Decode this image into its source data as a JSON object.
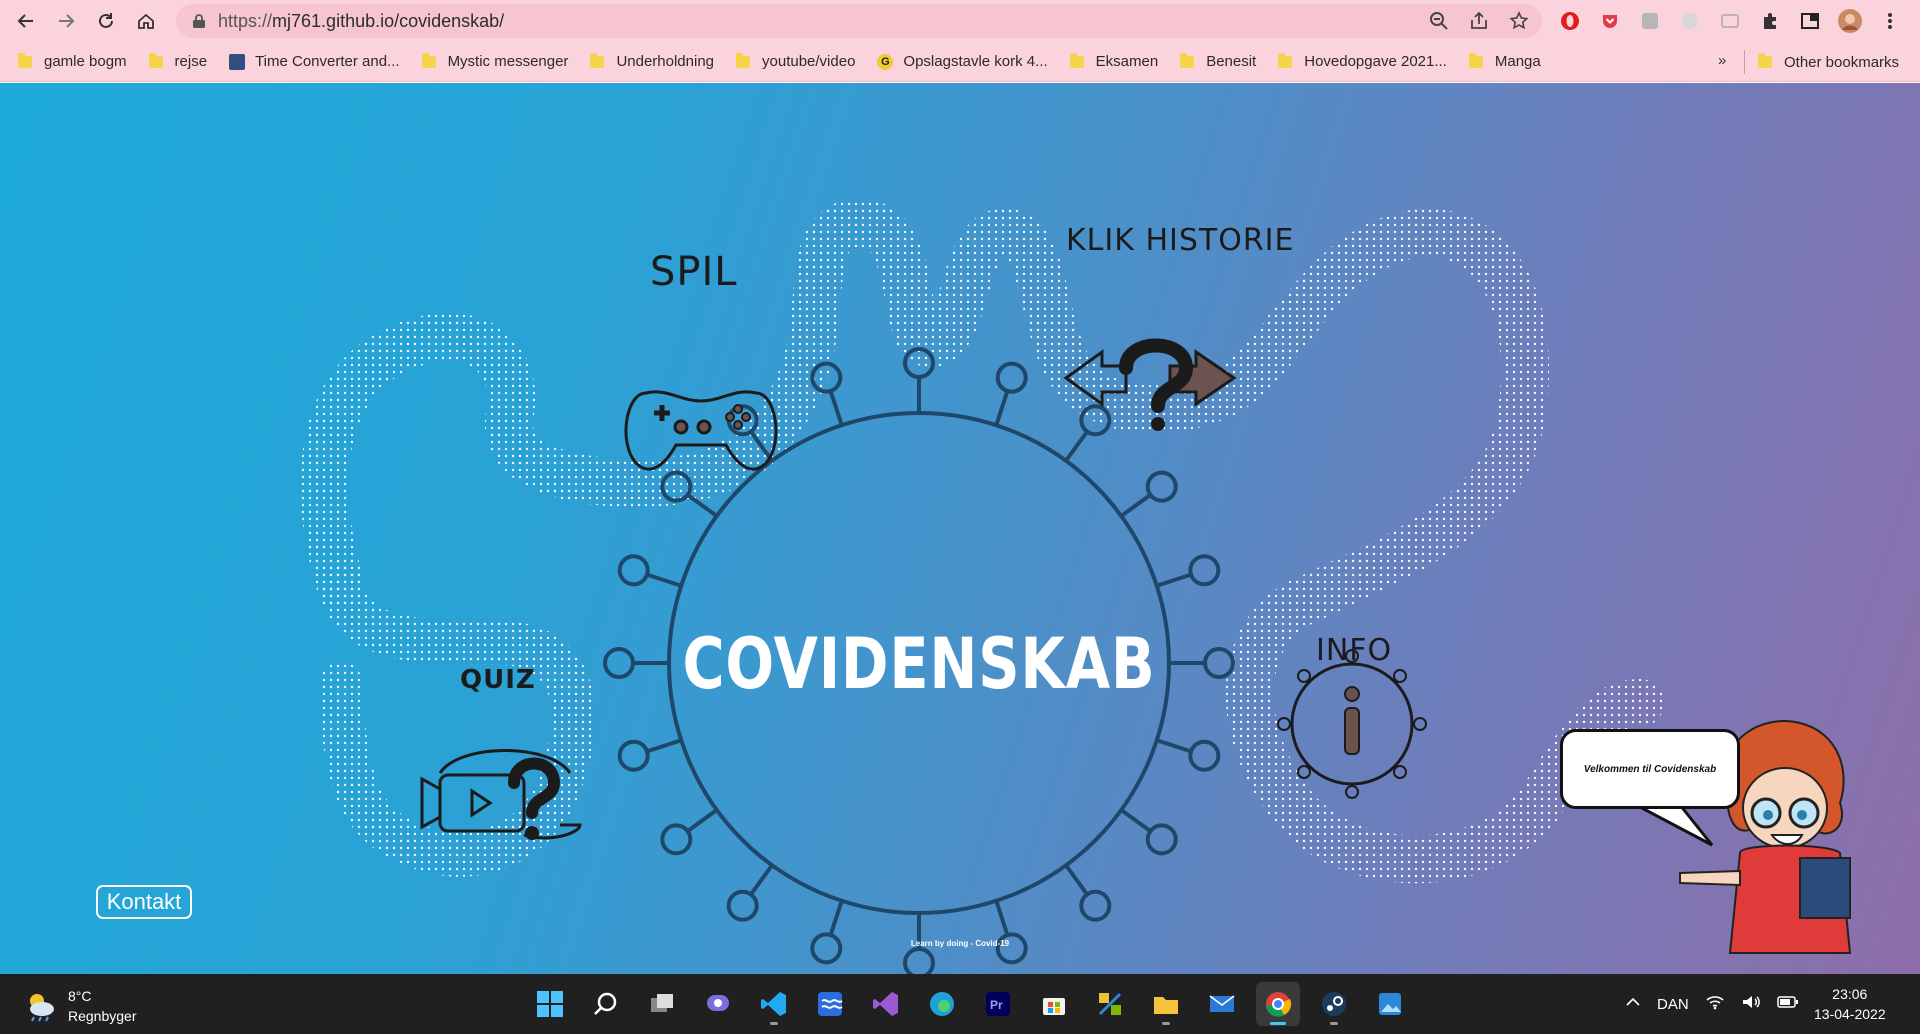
{
  "browser": {
    "url_scheme": "https://",
    "url_rest": "mj761.github.io/covidenskab/",
    "bookmarks": [
      {
        "label": "gamle bogm",
        "icon": "folder-icon"
      },
      {
        "label": "rejse",
        "icon": "folder-icon"
      },
      {
        "label": "Time Converter and...",
        "icon": "timeconverter-icon"
      },
      {
        "label": "Mystic messenger",
        "icon": "folder-icon"
      },
      {
        "label": "Underholdning",
        "icon": "folder-icon"
      },
      {
        "label": "youtube/video",
        "icon": "folder-icon"
      },
      {
        "label": "Opslagstavle kork 4...",
        "icon": "g-logo-icon"
      },
      {
        "label": "Eksamen",
        "icon": "folder-icon"
      },
      {
        "label": "Benesit",
        "icon": "folder-icon"
      },
      {
        "label": "Hovedopgave 2021...",
        "icon": "folder-icon"
      },
      {
        "label": "Manga",
        "icon": "folder-icon"
      }
    ],
    "bookmarks_more": "»",
    "other_bookmarks": "Other bookmarks"
  },
  "page": {
    "title": "COVIDENSKAB",
    "menu": {
      "spil": "SPIL",
      "klik_historie": "KLIK HISTORIE",
      "quiz": "QUIZ",
      "info": "INFO"
    },
    "kontakt": "Kontakt",
    "tagline": "Learn by doing - Covid-19",
    "speech_bubble": "Velkommen til Covidenskab",
    "colors": {
      "gradient_start": "#1daad9",
      "gradient_end": "#8e6ea9",
      "virus_outline": "#1f4769",
      "title": "#ffffff"
    }
  },
  "taskbar": {
    "temperature": "8°C",
    "weather": "Regnbyger",
    "language": "DAN",
    "time": "23:06",
    "date": "13-04-2022"
  }
}
